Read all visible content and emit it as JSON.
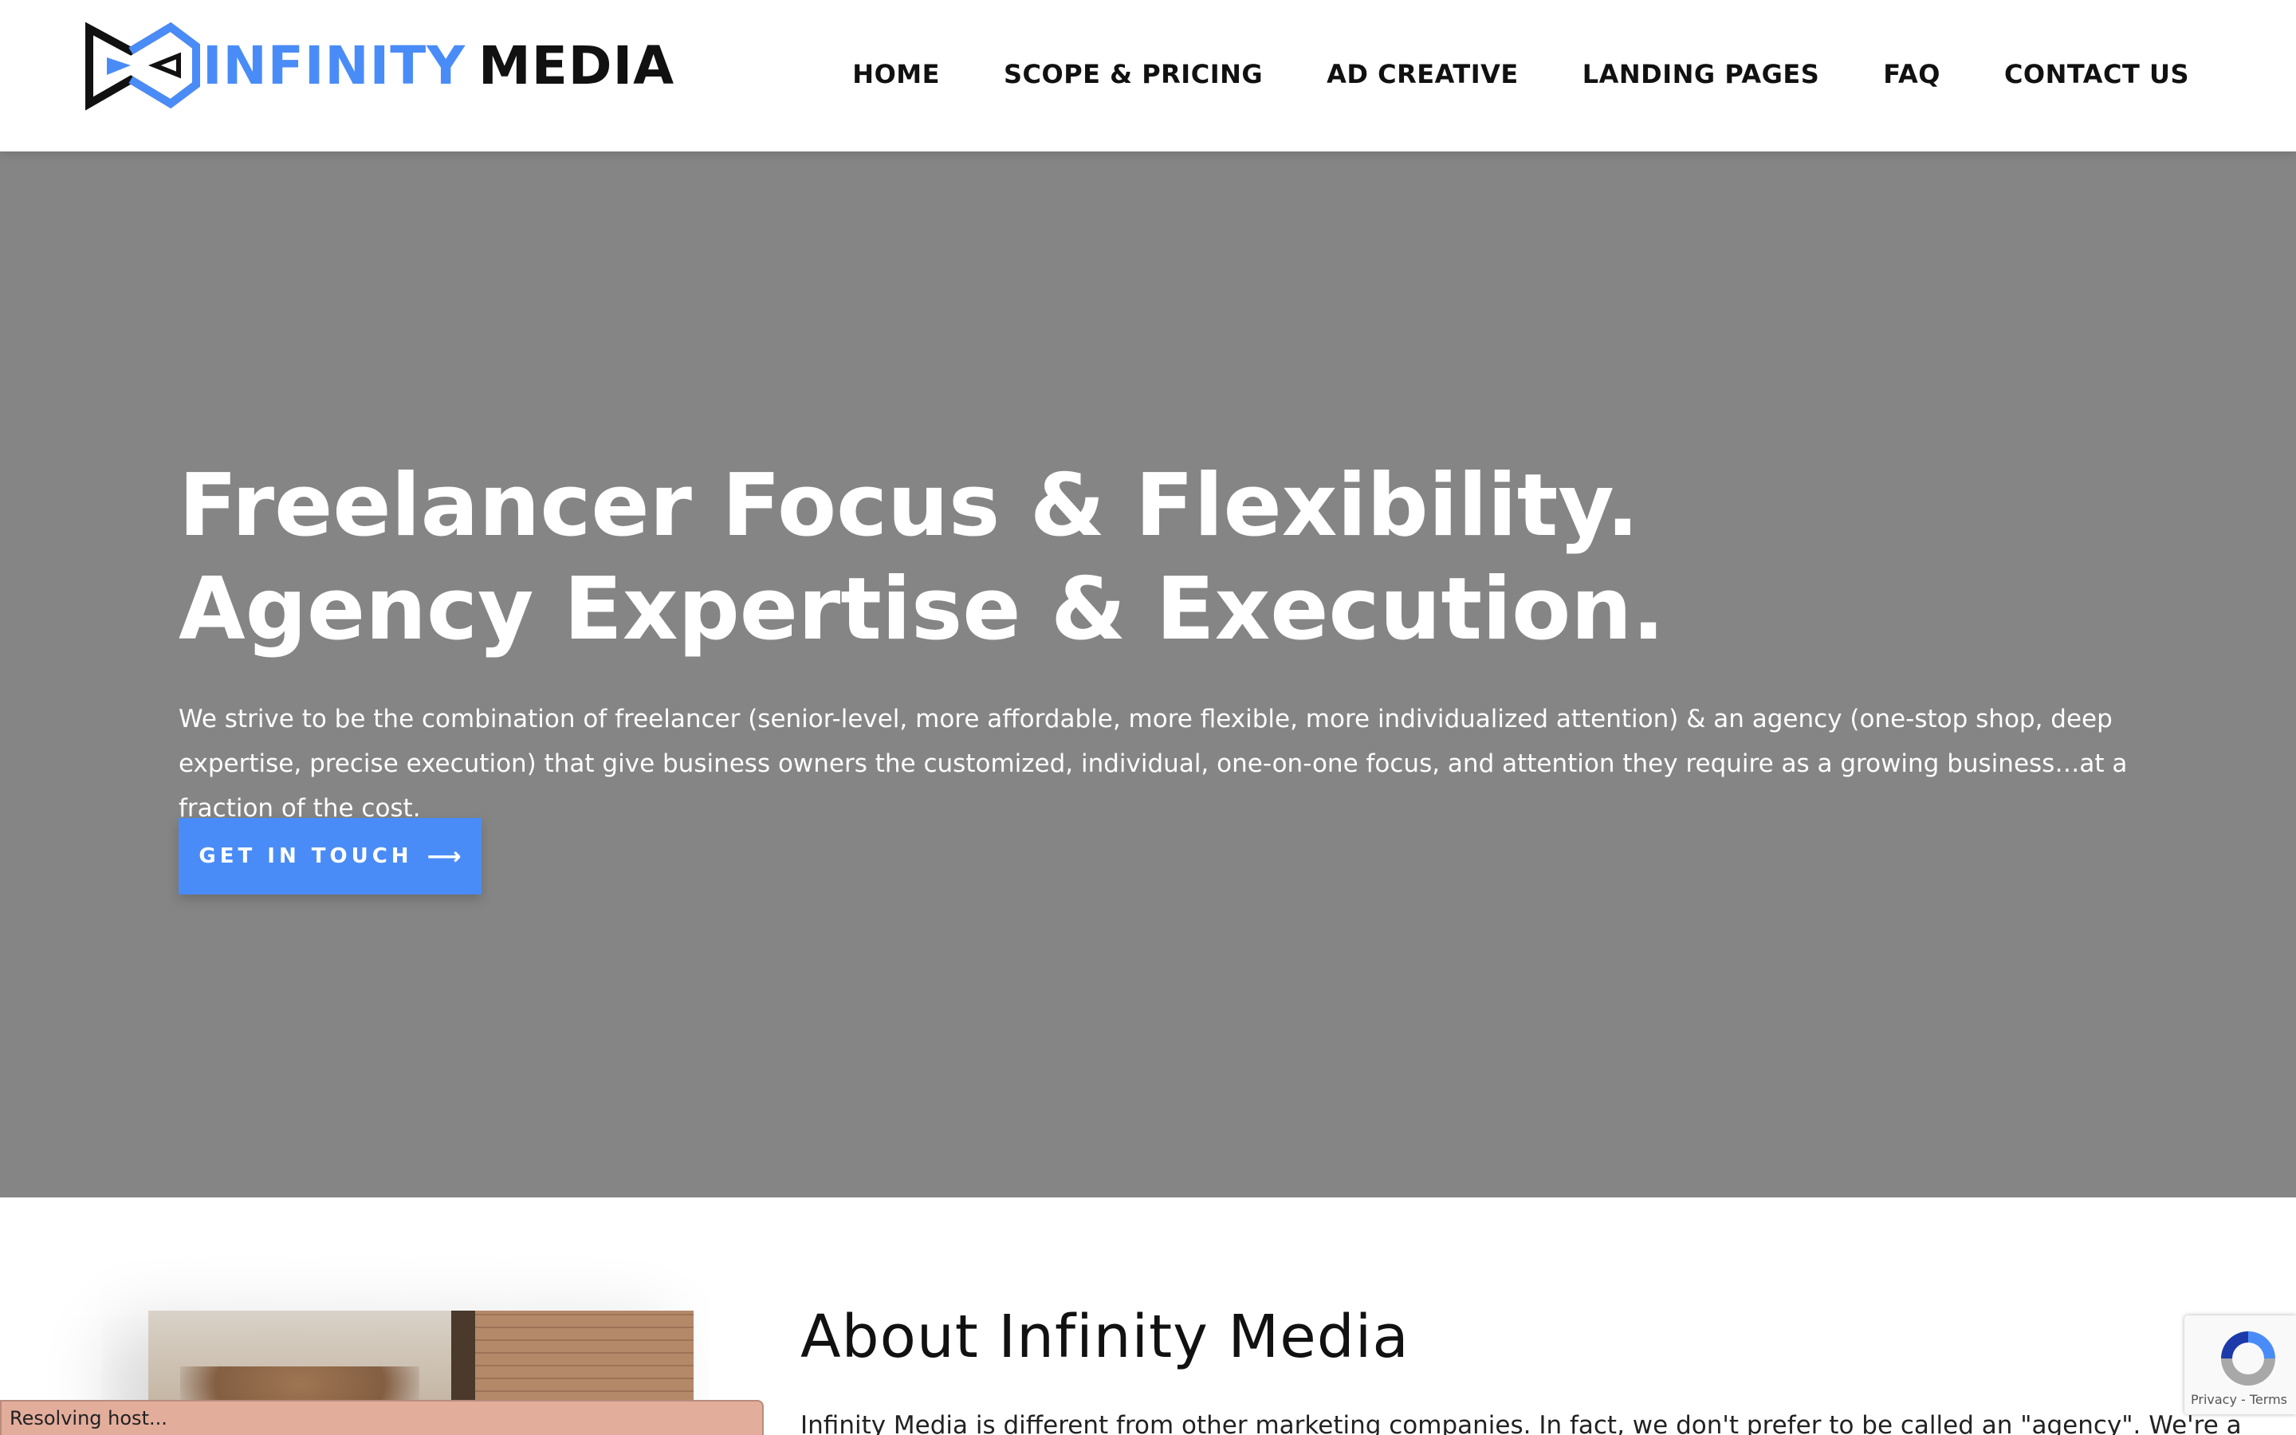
{
  "header": {
    "logo_word1": "INFINITY",
    "logo_word2": "MEDIA",
    "logo_icon": "infinity-logo-icon",
    "nav": [
      {
        "label": "HOME"
      },
      {
        "label": "SCOPE & PRICING"
      },
      {
        "label": "AD CREATIVE"
      },
      {
        "label": "LANDING PAGES"
      },
      {
        "label": "FAQ"
      },
      {
        "label": "CONTACT US"
      }
    ]
  },
  "hero": {
    "title_line1": "Freelancer Focus & Flexibility.",
    "title_line2": "Agency Expertise & Execution.",
    "description": "We strive to be the combination of freelancer (senior-level, more affordable, more flexible, more individualized attention) & an agency (one-stop shop, deep expertise, precise execution) that give business owners the customized, individual, one-on-one focus, and attention they require as a growing business…at a fraction of the cost.",
    "cta_label": "GET IN TOUCH",
    "cta_arrow": "⟶"
  },
  "about": {
    "title": "About Infinity Media",
    "text": "Infinity Media is different from other marketing companies. In fact, we don't prefer to be called an \"agency\".   We're a"
  },
  "status_bar": {
    "text": "Resolving host..."
  },
  "recaptcha": {
    "links": "Privacy - Terms"
  },
  "colors": {
    "accent": "#4a8cf7",
    "hero_bg": "#858585",
    "text_dark": "#111111"
  }
}
